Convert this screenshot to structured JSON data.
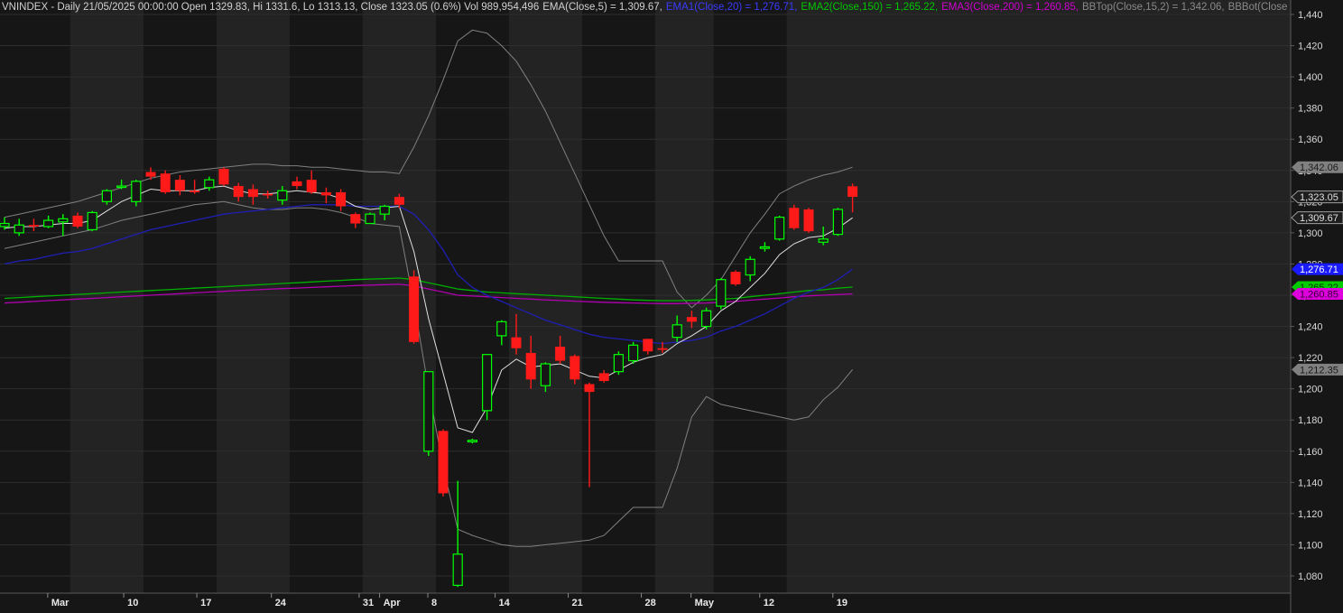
{
  "header": {
    "symbol_info": "VNINDEX - Daily 21/05/2025 00:00:00 Open 1329.83, Hi 1331.6, Lo 1313.13, Close 1323.05 (0.6%) Vol 989,954,496",
    "ema": "EMA(Close,5) = 1,309.67,",
    "ema1": "EMA1(Close,20) = 1,276.71,",
    "ema2": "EMA2(Close,150) = 1,265.22,",
    "ema3": "EMA3(Close,200) = 1,260.85,",
    "bbtop": "BBTop(Close,15,2) = 1,342.06,",
    "bbbot": "BBBot(Close"
  },
  "colors": {
    "background": "#161616",
    "band": "#232323",
    "up": "#00ff00",
    "down": "#ff1a1a",
    "ema": "#ffffff",
    "ema1": "#1f1fb4",
    "ema2": "#00b000",
    "ema3": "#b000b0",
    "bb": "#808080"
  },
  "chart_data": {
    "type": "candlestick",
    "title": "VNINDEX - Daily",
    "ylim": [
      1068,
      1446
    ],
    "y_ticks": [
      "1,080",
      "1,100",
      "1,120",
      "1,140",
      "1,160",
      "1,180",
      "1,200",
      "1,220",
      "1,240",
      "1,260",
      "1,280",
      "1,300",
      "1,320",
      "1,340",
      "1,360",
      "1,380",
      "1,400",
      "1,420",
      "1,440"
    ],
    "x_labels": [
      "Mar",
      "10",
      "17",
      "24",
      "31",
      "Apr",
      "8",
      "14",
      "21",
      "28",
      "May",
      "12",
      "19"
    ],
    "grid": true,
    "candles": [
      {
        "date": "2025-02-24",
        "o": 1304,
        "h": 1310,
        "l": 1302,
        "c": 1306
      },
      {
        "date": "2025-02-25",
        "o": 1300,
        "h": 1309,
        "l": 1298,
        "c": 1305
      },
      {
        "date": "2025-02-26",
        "o": 1305,
        "h": 1309,
        "l": 1301,
        "c": 1304
      },
      {
        "date": "2025-02-27",
        "o": 1304,
        "h": 1311,
        "l": 1303,
        "c": 1308
      },
      {
        "date": "2025-02-28",
        "o": 1307,
        "h": 1312,
        "l": 1298,
        "c": 1309
      },
      {
        "date": "2025-03-03",
        "o": 1311,
        "h": 1313,
        "l": 1303,
        "c": 1304
      },
      {
        "date": "2025-03-04",
        "o": 1302,
        "h": 1314,
        "l": 1301,
        "c": 1313
      },
      {
        "date": "2025-03-05",
        "o": 1320,
        "h": 1328,
        "l": 1318,
        "c": 1327
      },
      {
        "date": "2025-03-06",
        "o": 1330,
        "h": 1334,
        "l": 1328,
        "c": 1330
      },
      {
        "date": "2025-03-07",
        "o": 1320,
        "h": 1334,
        "l": 1317,
        "c": 1333
      },
      {
        "date": "2025-03-10",
        "o": 1339,
        "h": 1342,
        "l": 1334,
        "c": 1336
      },
      {
        "date": "2025-03-11",
        "o": 1338,
        "h": 1340,
        "l": 1325,
        "c": 1326
      },
      {
        "date": "2025-03-12",
        "o": 1334,
        "h": 1337,
        "l": 1324,
        "c": 1327
      },
      {
        "date": "2025-03-13",
        "o": 1327,
        "h": 1334,
        "l": 1325,
        "c": 1326
      },
      {
        "date": "2025-03-14",
        "o": 1329,
        "h": 1336,
        "l": 1327,
        "c": 1334
      },
      {
        "date": "2025-03-17",
        "o": 1341,
        "h": 1342,
        "l": 1330,
        "c": 1331
      },
      {
        "date": "2025-03-18",
        "o": 1330,
        "h": 1332,
        "l": 1320,
        "c": 1323
      },
      {
        "date": "2025-03-19",
        "o": 1328,
        "h": 1331,
        "l": 1318,
        "c": 1323
      },
      {
        "date": "2025-03-20",
        "o": 1325,
        "h": 1327,
        "l": 1322,
        "c": 1324
      },
      {
        "date": "2025-03-21",
        "o": 1321,
        "h": 1330,
        "l": 1318,
        "c": 1327
      },
      {
        "date": "2025-03-24",
        "o": 1333,
        "h": 1336,
        "l": 1328,
        "c": 1330
      },
      {
        "date": "2025-03-25",
        "o": 1334,
        "h": 1340,
        "l": 1325,
        "c": 1326
      },
      {
        "date": "2025-03-26",
        "o": 1326,
        "h": 1329,
        "l": 1319,
        "c": 1324
      },
      {
        "date": "2025-03-27",
        "o": 1326,
        "h": 1328,
        "l": 1314,
        "c": 1317
      },
      {
        "date": "2025-03-28",
        "o": 1312,
        "h": 1313,
        "l": 1303,
        "c": 1306
      },
      {
        "date": "2025-03-31",
        "o": 1306,
        "h": 1313,
        "l": 1306,
        "c": 1312
      },
      {
        "date": "2025-04-01",
        "o": 1312,
        "h": 1318,
        "l": 1308,
        "c": 1317
      },
      {
        "date": "2025-04-02",
        "o": 1323,
        "h": 1325,
        "l": 1316,
        "c": 1318
      },
      {
        "date": "2025-04-03",
        "o": 1272,
        "h": 1276,
        "l": 1229,
        "c": 1230
      },
      {
        "date": "2025-04-04",
        "o": 1160,
        "h": 1211,
        "l": 1157,
        "c": 1211
      },
      {
        "date": "2025-04-07",
        "o": 1173,
        "h": 1174,
        "l": 1131,
        "c": 1133
      },
      {
        "date": "2025-04-08",
        "o": 1074,
        "h": 1141,
        "l": 1073,
        "c": 1094
      },
      {
        "date": "2025-04-09",
        "o": 1166,
        "h": 1168,
        "l": 1165,
        "c": 1167
      },
      {
        "date": "2025-04-10",
        "o": 1186,
        "h": 1222,
        "l": 1180,
        "c": 1222
      },
      {
        "date": "2025-04-11",
        "o": 1234,
        "h": 1244,
        "l": 1228,
        "c": 1243
      },
      {
        "date": "2025-04-14",
        "o": 1233,
        "h": 1248,
        "l": 1222,
        "c": 1226
      },
      {
        "date": "2025-04-15",
        "o": 1223,
        "h": 1234,
        "l": 1200,
        "c": 1206
      },
      {
        "date": "2025-04-16",
        "o": 1202,
        "h": 1217,
        "l": 1198,
        "c": 1216
      },
      {
        "date": "2025-04-17",
        "o": 1227,
        "h": 1234,
        "l": 1216,
        "c": 1218
      },
      {
        "date": "2025-04-18",
        "o": 1221,
        "h": 1222,
        "l": 1203,
        "c": 1206
      },
      {
        "date": "2025-04-21",
        "o": 1203,
        "h": 1204,
        "l": 1137,
        "c": 1198
      },
      {
        "date": "2025-04-22",
        "o": 1210,
        "h": 1212,
        "l": 1204,
        "c": 1205
      },
      {
        "date": "2025-04-23",
        "o": 1211,
        "h": 1224,
        "l": 1209,
        "c": 1222
      },
      {
        "date": "2025-04-24",
        "o": 1218,
        "h": 1230,
        "l": 1216,
        "c": 1228
      },
      {
        "date": "2025-04-25",
        "o": 1232,
        "h": 1232,
        "l": 1222,
        "c": 1224
      },
      {
        "date": "2025-04-28",
        "o": 1226,
        "h": 1230,
        "l": 1223,
        "c": 1225
      },
      {
        "date": "2025-05-05",
        "o": 1233,
        "h": 1247,
        "l": 1230,
        "c": 1241
      },
      {
        "date": "2025-05-06",
        "o": 1246,
        "h": 1250,
        "l": 1239,
        "c": 1243
      },
      {
        "date": "2025-05-07",
        "o": 1240,
        "h": 1252,
        "l": 1238,
        "c": 1250
      },
      {
        "date": "2025-05-08",
        "o": 1253,
        "h": 1271,
        "l": 1251,
        "c": 1270
      },
      {
        "date": "2025-05-09",
        "o": 1275,
        "h": 1276,
        "l": 1266,
        "c": 1267
      },
      {
        "date": "2025-05-12",
        "o": 1273,
        "h": 1285,
        "l": 1269,
        "c": 1283
      },
      {
        "date": "2025-05-13",
        "o": 1290,
        "h": 1294,
        "l": 1288,
        "c": 1291
      },
      {
        "date": "2025-05-14",
        "o": 1296,
        "h": 1311,
        "l": 1295,
        "c": 1310
      },
      {
        "date": "2025-05-15",
        "o": 1316,
        "h": 1318,
        "l": 1302,
        "c": 1303
      },
      {
        "date": "2025-05-16",
        "o": 1315,
        "h": 1316,
        "l": 1300,
        "c": 1301
      },
      {
        "date": "2025-05-19",
        "o": 1294,
        "h": 1304,
        "l": 1292,
        "c": 1296
      },
      {
        "date": "2025-05-20",
        "o": 1299,
        "h": 1316,
        "l": 1298,
        "c": 1315
      },
      {
        "date": "2025-05-21",
        "o": 1329.83,
        "h": 1331.6,
        "l": 1313.13,
        "c": 1323.05
      }
    ],
    "ema5": [
      1303,
      1304,
      1304,
      1305,
      1306,
      1306,
      1308,
      1314,
      1320,
      1324,
      1328,
      1327,
      1327,
      1327,
      1329,
      1330,
      1327,
      1325,
      1325,
      1326,
      1327,
      1326,
      1325,
      1322,
      1317,
      1315,
      1316,
      1317,
      1288,
      1245,
      1210,
      1175,
      1172,
      1188,
      1212,
      1219,
      1214,
      1215,
      1216,
      1212,
      1208,
      1207,
      1212,
      1217,
      1220,
      1222,
      1229,
      1234,
      1240,
      1250,
      1256,
      1265,
      1274,
      1286,
      1293,
      1297,
      1298,
      1303,
      1309.67
    ],
    "ema20": [
      1280,
      1282,
      1283,
      1285,
      1287,
      1288,
      1290,
      1293,
      1296,
      1299,
      1302,
      1304,
      1306,
      1308,
      1310,
      1312,
      1313,
      1314,
      1315,
      1316,
      1317,
      1318,
      1318,
      1318,
      1317,
      1317,
      1317,
      1317,
      1312,
      1302,
      1289,
      1273,
      1265,
      1260,
      1256,
      1252,
      1248,
      1244,
      1241,
      1238,
      1235,
      1233,
      1232,
      1231,
      1230,
      1229,
      1230,
      1231,
      1233,
      1237,
      1240,
      1244,
      1248,
      1253,
      1258,
      1262,
      1265,
      1270,
      1276.71
    ],
    "ema150": [
      1258,
      1258.5,
      1259,
      1259.5,
      1260,
      1260.5,
      1261,
      1261.5,
      1262,
      1262.5,
      1263,
      1263.5,
      1264,
      1264.5,
      1265,
      1265.5,
      1266,
      1266.5,
      1267,
      1267.5,
      1268,
      1268.5,
      1269,
      1269.5,
      1270,
      1270.3,
      1270.6,
      1271,
      1270,
      1268,
      1266,
      1264,
      1263,
      1262,
      1261.5,
      1261,
      1260.5,
      1260,
      1259.5,
      1259,
      1258.5,
      1258,
      1257.5,
      1257,
      1256.7,
      1256.5,
      1256.5,
      1256.7,
      1257,
      1257.5,
      1258,
      1259,
      1260,
      1261,
      1262,
      1263,
      1263.5,
      1264.5,
      1265.22
    ],
    "ema200": [
      1255,
      1255.5,
      1256,
      1256.5,
      1257,
      1257.5,
      1258,
      1258.5,
      1259,
      1259.5,
      1260,
      1260.5,
      1261,
      1261.5,
      1262,
      1262.5,
      1263,
      1263.4,
      1263.8,
      1264.2,
      1264.6,
      1265,
      1265.4,
      1265.8,
      1266.2,
      1266.5,
      1266.8,
      1267,
      1266,
      1264,
      1262,
      1260,
      1259.5,
      1259,
      1258.5,
      1258,
      1257.5,
      1257,
      1256.6,
      1256.2,
      1255.8,
      1255.5,
      1255.2,
      1255,
      1254.8,
      1254.6,
      1254.6,
      1254.8,
      1255,
      1255.5,
      1256,
      1256.8,
      1257.5,
      1258.2,
      1259,
      1259.6,
      1260,
      1260.4,
      1260.85
    ],
    "bb_top": [
      1310,
      1312,
      1314,
      1316,
      1318,
      1320,
      1323,
      1326,
      1329,
      1332,
      1335,
      1337,
      1339,
      1340,
      1341,
      1342,
      1343,
      1344,
      1344,
      1343,
      1343,
      1342,
      1342,
      1341,
      1340,
      1339,
      1339,
      1338,
      1355,
      1375,
      1398,
      1423,
      1430,
      1428,
      1420,
      1410,
      1395,
      1378,
      1358,
      1338,
      1318,
      1298,
      1282,
      1282,
      1282,
      1282,
      1262,
      1252,
      1260,
      1270,
      1285,
      1300,
      1312,
      1325,
      1330,
      1334,
      1337,
      1339,
      1342.06
    ],
    "bb_bot": [
      1290,
      1292,
      1294,
      1296,
      1298,
      1300,
      1302,
      1305,
      1308,
      1310,
      1312,
      1314,
      1316,
      1318,
      1319,
      1320,
      1318,
      1316,
      1315,
      1315,
      1316,
      1316,
      1315,
      1313,
      1310,
      1306,
      1305,
      1304,
      1255,
      1200,
      1150,
      1110,
      1106,
      1103,
      1100,
      1099,
      1099,
      1100,
      1101,
      1102,
      1103,
      1106,
      1115,
      1124,
      1124,
      1124,
      1149,
      1182,
      1195,
      1190,
      1188,
      1186,
      1184,
      1182,
      1180,
      1182,
      1193,
      1201,
      1212.35
    ],
    "value_tags": [
      {
        "label": "1,342.06",
        "value": 1342.06,
        "bg": "#808080",
        "fg": "#1a1a1a"
      },
      {
        "label": "1,323.05",
        "value": 1323.05,
        "bg": "#1e1e1e",
        "fg": "#e0e0e0",
        "border": "#a0a0a0"
      },
      {
        "label": "1,309.67",
        "value": 1309.67,
        "bg": "#1e1e1e",
        "fg": "#e0e0e0",
        "border": "#a0a0a0"
      },
      {
        "label": "1,276.71",
        "value": 1276.71,
        "bg": "#1a1aff",
        "fg": "#ffffff"
      },
      {
        "label": "1,265.22",
        "value": 1265.22,
        "bg": "#00cc00",
        "fg": "#003300"
      },
      {
        "label": "1,260.85",
        "value": 1260.85,
        "bg": "#dd00dd",
        "fg": "#330033"
      },
      {
        "label": "1,212.35",
        "value": 1212.35,
        "bg": "#808080",
        "fg": "#1a1a1a"
      }
    ]
  }
}
